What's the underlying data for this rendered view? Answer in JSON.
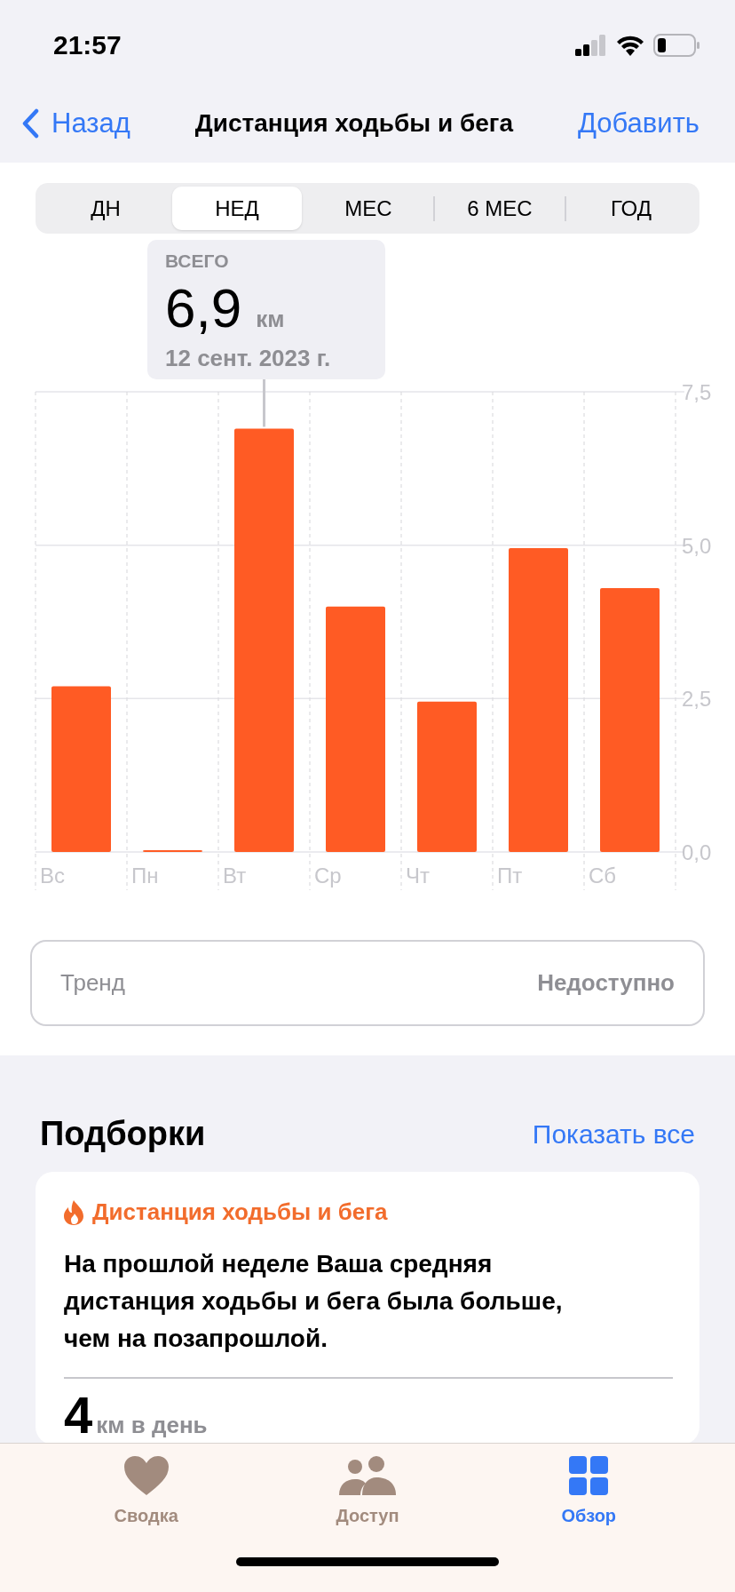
{
  "status_bar": {
    "time": "21:57"
  },
  "nav": {
    "back": "Назад",
    "title": "Дистанция ходьбы и бега",
    "action": "Добавить"
  },
  "periods": [
    {
      "label": "ДН",
      "selected": false
    },
    {
      "label": "НЕД",
      "selected": true
    },
    {
      "label": "МЕС",
      "selected": false
    },
    {
      "label": "6 МЕС",
      "selected": false
    },
    {
      "label": "ГОД",
      "selected": false
    }
  ],
  "summary": {
    "label": "ВСЕГО",
    "value": "6,9",
    "unit": "км",
    "date": "12 сент. 2023 г."
  },
  "chart_data": {
    "type": "bar",
    "categories": [
      "Вс",
      "Пн",
      "Вт",
      "Ср",
      "Чт",
      "Пт",
      "Сб"
    ],
    "series": [
      {
        "color": "#ff5b24",
        "values": [
          2.7,
          0.03,
          6.9,
          4.0,
          2.45,
          4.95,
          4.3
        ]
      }
    ],
    "ylim": [
      0,
      7.5
    ],
    "yticks": [
      {
        "value": 0,
        "label": "0,0"
      },
      {
        "value": 2.5,
        "label": "2,5"
      },
      {
        "value": 5,
        "label": "5,0"
      },
      {
        "value": 7.5,
        "label": "7,5"
      }
    ]
  },
  "trend": {
    "label": "Тренд",
    "value": "Недоступно"
  },
  "highlights": {
    "title": "Подборки",
    "link": "Показать все",
    "card": {
      "category": "Дистанция ходьбы и бега",
      "text": "На прошлой неделе Ваша средняя дистанция ходьбы и бега была больше, чем на позапрошлой.",
      "value": "4",
      "unit": "км в день"
    }
  },
  "tab_bar": [
    {
      "label": "Сводка",
      "kind": "heart",
      "selected": false
    },
    {
      "label": "Доступ",
      "kind": "people",
      "selected": false
    },
    {
      "label": "Обзор",
      "kind": "grid",
      "selected": true
    }
  ]
}
